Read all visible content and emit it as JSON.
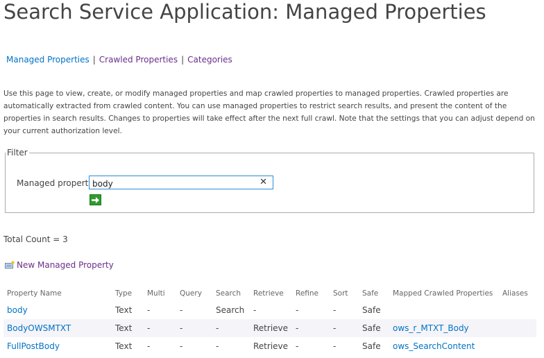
{
  "page": {
    "title": "Search Service Application: Managed Properties"
  },
  "nav": {
    "items": [
      {
        "label": "Managed Properties",
        "color": "#0072c6"
      },
      {
        "label": "Crawled Properties",
        "color": "#6b2e8a"
      },
      {
        "label": "Categories",
        "color": "#6b2e8a"
      }
    ],
    "separator": "|"
  },
  "intro": {
    "text": "Use this page to view, create, or modify managed properties and map crawled properties to managed properties. Crawled properties are automatically extracted from crawled content. You can use managed properties to restrict search results, and present the content of the properties in search results. Changes to properties will take effect after the next full crawl. Note that the settings that you can adjust depend on your current authorization level."
  },
  "filter": {
    "legend": "Filter",
    "label": "Managed property",
    "value": "body",
    "clear_icon": "close-icon",
    "go_icon": "arrow-right-icon"
  },
  "total": {
    "text": "Total Count = 3"
  },
  "new_property": {
    "label": "New Managed Property",
    "icon": "new-item-icon",
    "color": "#6b2e8a"
  },
  "table": {
    "columns": [
      "Property Name",
      "Type",
      "Multi",
      "Query",
      "Search",
      "Retrieve",
      "Refine",
      "Sort",
      "Safe",
      "Mapped Crawled Properties",
      "Aliases"
    ],
    "rows": [
      {
        "name": "body",
        "type": "Text",
        "multi": "-",
        "query": "-",
        "search": "Search",
        "retrieve": "-",
        "refine": "-",
        "sort": "-",
        "safe": "Safe",
        "mapped": "",
        "aliases": ""
      },
      {
        "name": "BodyOWSMTXT",
        "type": "Text",
        "multi": "-",
        "query": "-",
        "search": "-",
        "retrieve": "Retrieve",
        "refine": "-",
        "sort": "-",
        "safe": "Safe",
        "mapped": "ows_r_MTXT_Body",
        "aliases": ""
      },
      {
        "name": "FullPostBody",
        "type": "Text",
        "multi": "-",
        "query": "-",
        "search": "-",
        "retrieve": "Retrieve",
        "refine": "-",
        "sort": "-",
        "safe": "Safe",
        "mapped": "ows_SearchContent",
        "aliases": ""
      }
    ],
    "link_color": "#0072c6"
  }
}
